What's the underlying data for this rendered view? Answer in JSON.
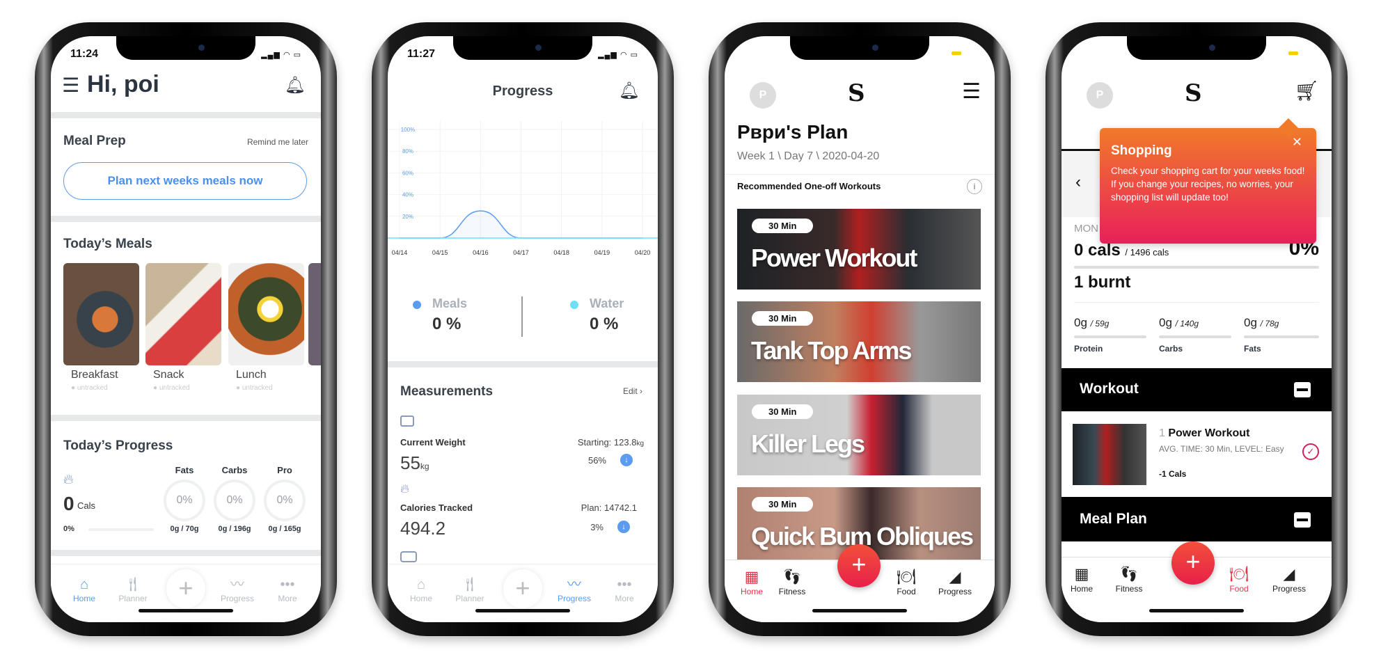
{
  "phone1": {
    "status_time": "11:24",
    "greeting": "Hi, poi",
    "meal_prep": {
      "title": "Meal Prep",
      "remind": "Remind me later",
      "button": "Plan next weeks meals now"
    },
    "todays_meals": {
      "title": "Today’s Meals",
      "items": [
        {
          "name": "Breakfast",
          "status": "untracked"
        },
        {
          "name": "Snack",
          "status": "untracked"
        },
        {
          "name": "Lunch",
          "status": "untracked"
        }
      ]
    },
    "todays_progress": {
      "title": "Today’s Progress",
      "cals_value": "0",
      "cals_unit": "Cals",
      "cals_percent": "0%",
      "macros": [
        {
          "label": "Fats",
          "percent": "0%",
          "amount": "0g / 70g"
        },
        {
          "label": "Carbs",
          "percent": "0%",
          "amount": "0g / 196g"
        },
        {
          "label": "Pro",
          "percent": "0%",
          "amount": "0g / 165g"
        }
      ]
    },
    "tabs": [
      "Home",
      "Planner",
      "Progress",
      "More"
    ],
    "active_tab": "Home",
    "accent": "#5b9cf0"
  },
  "phone2": {
    "status_time": "11:27",
    "title": "Progress",
    "chart_data": {
      "type": "line",
      "x": [
        "04/14",
        "04/15",
        "04/16",
        "04/17",
        "04/18",
        "04/19",
        "04/20"
      ],
      "series": [
        {
          "values": [
            0,
            0,
            25,
            0,
            0,
            0,
            0
          ]
        }
      ],
      "yticks": [
        "20%",
        "40%",
        "60%",
        "80%",
        "100%"
      ],
      "ylim": [
        0,
        100
      ],
      "grid": true
    },
    "legend": [
      {
        "name": "Meals",
        "value": "0 %",
        "color": "#5b9cf0"
      },
      {
        "name": "Water",
        "value": "0 %",
        "color": "#6ee0f5"
      }
    ],
    "measurements": {
      "title": "Measurements",
      "edit": "Edit",
      "weight": {
        "label": "Current Weight",
        "value": "55",
        "unit": "kg",
        "starting": "Starting: 123.8",
        "starting_unit": "kg",
        "change": "56%"
      },
      "calories": {
        "label": "Calories Tracked",
        "value": "494.2",
        "plan": "Plan: 14742.1",
        "change": "3%"
      }
    },
    "tabs": [
      "Home",
      "Planner",
      "Progress",
      "More"
    ],
    "active_tab": "Progress"
  },
  "phone3": {
    "avatar": "P",
    "title": "Рври's Plan",
    "subtitle": "Week 1 \\ Day 7 \\ 2020-04-20",
    "section": "Recommended One-off Workouts",
    "workouts": [
      {
        "duration": "30 Min",
        "name": "Power Workout"
      },
      {
        "duration": "30 Min",
        "name": "Tank Top Arms"
      },
      {
        "duration": "30 Min",
        "name": "Killer Legs"
      },
      {
        "duration": "30 Min",
        "name": "Quick Bum Obliques"
      }
    ],
    "tabs": [
      "Home",
      "Fitness",
      "Food",
      "Progress"
    ],
    "active_tab": "Home",
    "accent": "#e8344a"
  },
  "phone4": {
    "avatar": "P",
    "day_label": "MON",
    "cals": "0 cals",
    "cals_goal": "/ 1496 cals",
    "cals_percent": "0%",
    "burnt": "1 burnt",
    "macros": [
      {
        "value": "0g",
        "goal": "/ 59g",
        "label": "Protein"
      },
      {
        "value": "0g",
        "goal": "/ 140g",
        "label": "Carbs"
      },
      {
        "value": "0g",
        "goal": "/ 78g",
        "label": "Fats"
      }
    ],
    "workout_section": "Workout",
    "workout_item": {
      "count": "1",
      "name": "Power Workout",
      "details": "AVG. TIME: 30 Min, LEVEL: Easy",
      "cals": "-1 Cals"
    },
    "meal_plan_section": "Meal Plan",
    "tooltip": {
      "title": "Shopping",
      "body": "Check your shopping cart for your weeks food!  If you change your recipes, no worries, your shopping list will update too!"
    },
    "tabs": [
      "Home",
      "Fitness",
      "Food",
      "Progress"
    ],
    "active_tab": "Food"
  }
}
